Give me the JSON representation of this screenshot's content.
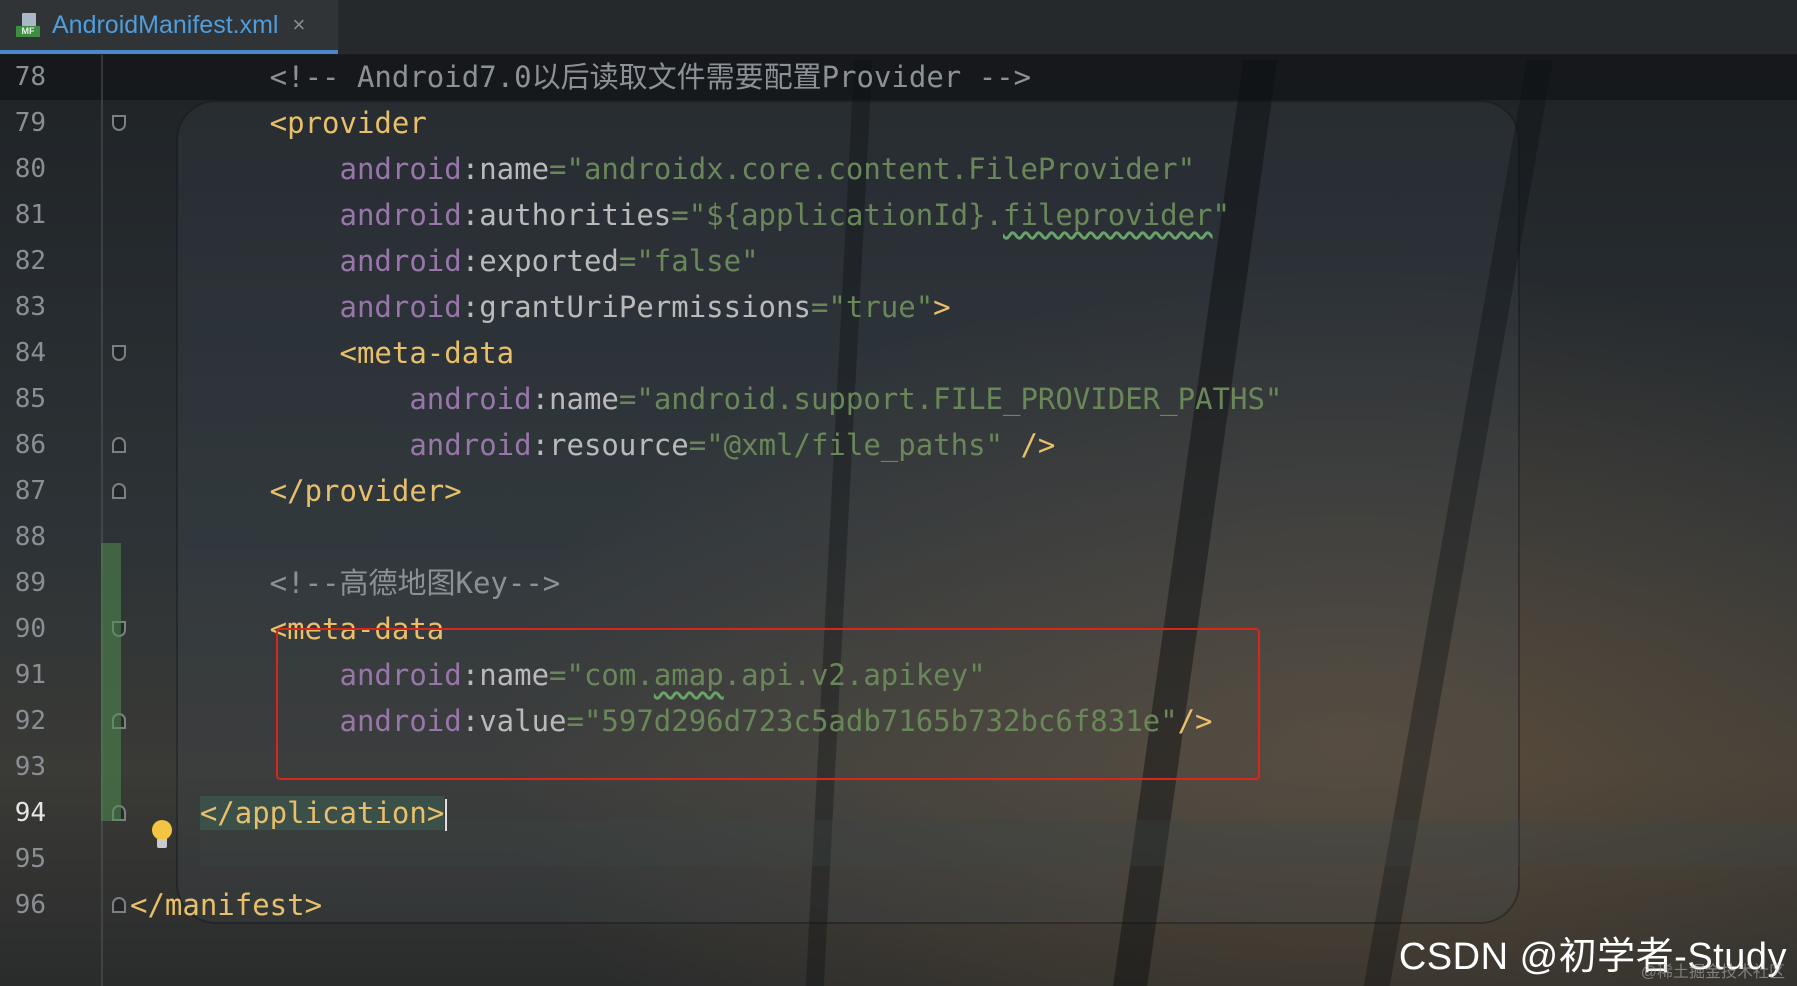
{
  "tab": {
    "title": "AndroidManifest.xml",
    "close_glyph": "×",
    "icon": "manifest-file-icon",
    "badge": "MF"
  },
  "editor": {
    "current_line": 94,
    "lines": [
      {
        "num": "78",
        "fold": "",
        "segments": [
          {
            "cls": "c-comment",
            "text": "        <!-- Android7.0以后读取文件需要配置Provider -->"
          }
        ]
      },
      {
        "num": "79",
        "fold": "open",
        "segments": [
          {
            "cls": "c-tag",
            "text": "        <provider"
          }
        ]
      },
      {
        "num": "80",
        "fold": "",
        "segments": [
          {
            "cls": "c-ns",
            "text": "            android"
          },
          {
            "cls": "c-attr",
            "text": ":name"
          },
          {
            "cls": "c-eq",
            "text": "="
          },
          {
            "cls": "c-val",
            "text": "\"androidx.core.content.FileProvider\""
          }
        ]
      },
      {
        "num": "81",
        "fold": "",
        "segments": [
          {
            "cls": "c-ns",
            "text": "            android"
          },
          {
            "cls": "c-attr",
            "text": ":authorities"
          },
          {
            "cls": "c-eq",
            "text": "="
          },
          {
            "cls": "c-val",
            "text": "\"${applicationId}."
          },
          {
            "cls": "c-val squiggle",
            "text": "fileprovider"
          },
          {
            "cls": "c-val",
            "text": "\""
          }
        ]
      },
      {
        "num": "82",
        "fold": "",
        "segments": [
          {
            "cls": "c-ns",
            "text": "            android"
          },
          {
            "cls": "c-attr",
            "text": ":exported"
          },
          {
            "cls": "c-eq",
            "text": "="
          },
          {
            "cls": "c-val",
            "text": "\"false\""
          }
        ]
      },
      {
        "num": "83",
        "fold": "",
        "segments": [
          {
            "cls": "c-ns",
            "text": "            android"
          },
          {
            "cls": "c-attr",
            "text": ":grantUriPermissions"
          },
          {
            "cls": "c-eq",
            "text": "="
          },
          {
            "cls": "c-val",
            "text": "\"true\""
          },
          {
            "cls": "c-tag",
            "text": ">"
          }
        ]
      },
      {
        "num": "84",
        "fold": "open",
        "segments": [
          {
            "cls": "c-tag",
            "text": "            <meta-data"
          }
        ]
      },
      {
        "num": "85",
        "fold": "",
        "segments": [
          {
            "cls": "c-ns",
            "text": "                android"
          },
          {
            "cls": "c-attr",
            "text": ":name"
          },
          {
            "cls": "c-eq",
            "text": "="
          },
          {
            "cls": "c-val",
            "text": "\"android.support.FILE_PROVIDER_PATHS\""
          }
        ]
      },
      {
        "num": "86",
        "fold": "close",
        "segments": [
          {
            "cls": "c-ns",
            "text": "                android"
          },
          {
            "cls": "c-attr",
            "text": ":resource"
          },
          {
            "cls": "c-eq",
            "text": "="
          },
          {
            "cls": "c-val",
            "text": "\"@xml/file_paths\""
          },
          {
            "cls": "c-tag",
            "text": " />"
          }
        ]
      },
      {
        "num": "87",
        "fold": "close",
        "segments": [
          {
            "cls": "c-tag",
            "text": "        </provider>"
          }
        ]
      },
      {
        "num": "88",
        "fold": "",
        "segments": []
      },
      {
        "num": "89",
        "fold": "",
        "segments": [
          {
            "cls": "c-comment",
            "text": "        <!--高德地图Key-->"
          }
        ]
      },
      {
        "num": "90",
        "fold": "open",
        "segments": [
          {
            "cls": "c-tag",
            "text": "        <meta-data"
          }
        ]
      },
      {
        "num": "91",
        "fold": "",
        "segments": [
          {
            "cls": "c-ns",
            "text": "            android"
          },
          {
            "cls": "c-attr",
            "text": ":name"
          },
          {
            "cls": "c-eq",
            "text": "="
          },
          {
            "cls": "c-val",
            "text": "\"com."
          },
          {
            "cls": "c-val squiggle",
            "text": "amap"
          },
          {
            "cls": "c-val",
            "text": ".api.v2.apikey\""
          }
        ]
      },
      {
        "num": "92",
        "fold": "close",
        "segments": [
          {
            "cls": "c-ns",
            "text": "            android"
          },
          {
            "cls": "c-attr",
            "text": ":value"
          },
          {
            "cls": "c-eq",
            "text": "="
          },
          {
            "cls": "c-val",
            "text": "\"597d296d723c5adb7165b732bc6f831e\""
          },
          {
            "cls": "c-tag",
            "text": "/>"
          }
        ]
      },
      {
        "num": "93",
        "fold": "",
        "segments": []
      },
      {
        "num": "94",
        "fold": "close",
        "segments": [
          {
            "cls": "c-tag",
            "text": "    "
          },
          {
            "cls": "c-tag tag-hl",
            "text": "</application>"
          }
        ]
      },
      {
        "num": "95",
        "fold": "",
        "segments": []
      },
      {
        "num": "96",
        "fold": "close",
        "segments": [
          {
            "cls": "c-tag",
            "text": "</manifest>"
          }
        ]
      }
    ]
  },
  "watermark": {
    "text": "CSDN @初学者-Study",
    "sub": "@稀土掘金技术社区"
  },
  "colors": {
    "comment": "#8c9198",
    "tag": "#e8bf6a",
    "namespace": "#9876aa",
    "attribute": "#bababa",
    "value": "#6a8759",
    "highlight_box": "#d9261c",
    "tab_accent": "#4a88c7"
  }
}
